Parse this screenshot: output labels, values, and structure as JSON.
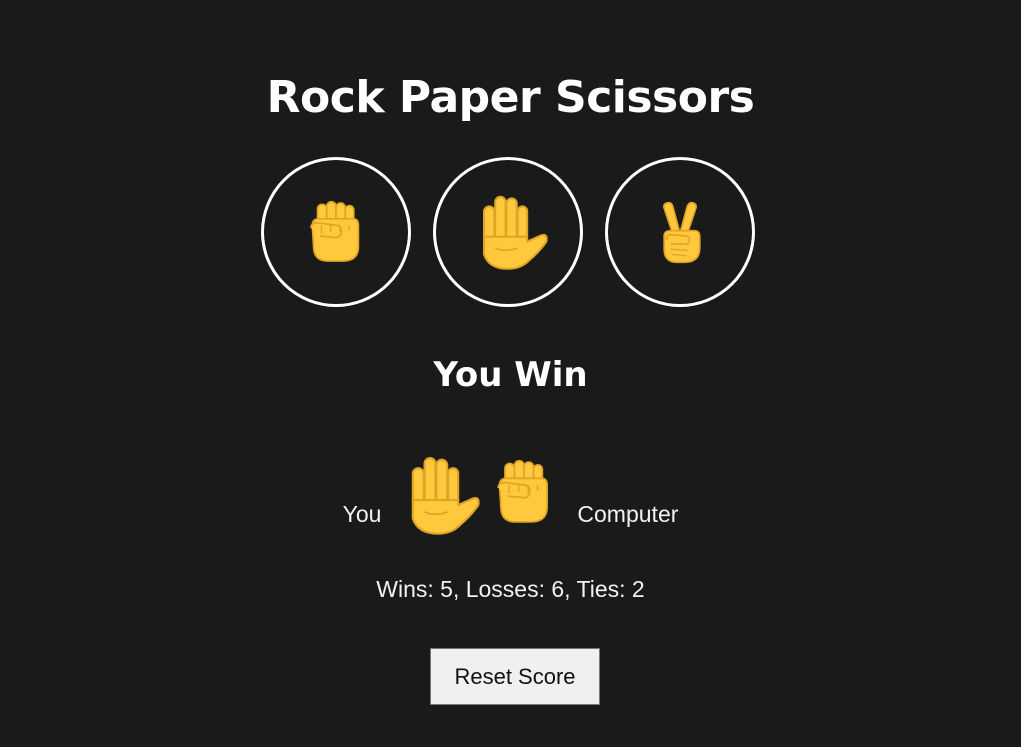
{
  "title": "Rock Paper Scissors",
  "choices": [
    {
      "name": "rock",
      "icon": "raised-fist-icon"
    },
    {
      "name": "paper",
      "icon": "raised-hand-icon"
    },
    {
      "name": "scissors",
      "icon": "victory-hand-icon"
    }
  ],
  "result": "You Win",
  "moves": {
    "you_label": "You",
    "you_move_icon": "raised-hand-icon",
    "computer_move_icon": "raised-fist-icon",
    "computer_label": "Computer"
  },
  "score": "Wins: 5, Losses: 6, Ties: 2",
  "reset_label": "Reset Score",
  "colors": {
    "background": "#1a1a1a",
    "text": "#ffffff",
    "hand": "#FFC83D",
    "hand_shadow": "#E0A424",
    "button": "#f0f0f0"
  }
}
